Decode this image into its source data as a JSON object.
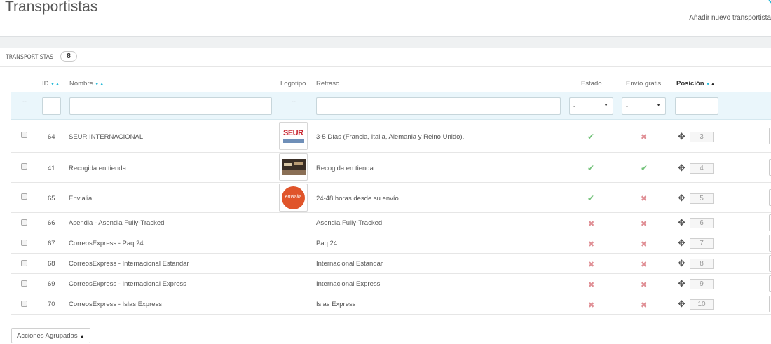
{
  "page": {
    "title": "Transportistas",
    "add_new": "Añadir nuevo transportista"
  },
  "panel": {
    "title": "TRANSPORTISTAS",
    "count": "8"
  },
  "columns": {
    "id": "ID",
    "name": "Nombre",
    "logo": "Logotipo",
    "delay": "Retraso",
    "status": "Estado",
    "free_shipping": "Envío gratis",
    "position": "Posición"
  },
  "filters": {
    "select_placeholder": "--",
    "status_value": "-",
    "free_value": "-"
  },
  "rows": [
    {
      "id": "64",
      "name": "SEUR INTERNACIONAL",
      "logo": "seur",
      "delay": "3-5 Días (Francia, Italia, Alemania y Reino Unido).",
      "status": true,
      "free": false,
      "position": "3"
    },
    {
      "id": "41",
      "name": "Recogida en tienda",
      "logo": "store",
      "delay": "Recogida en tienda",
      "status": true,
      "free": true,
      "position": "4"
    },
    {
      "id": "65",
      "name": "Envialia",
      "logo": "envialia",
      "delay": "24-48 horas desde su envío.",
      "status": true,
      "free": false,
      "position": "5"
    },
    {
      "id": "66",
      "name": "Asendia - Asendia Fully-Tracked",
      "logo": "",
      "delay": "Asendia Fully-Tracked",
      "status": false,
      "free": false,
      "position": "6"
    },
    {
      "id": "67",
      "name": "CorreosExpress - Paq 24",
      "logo": "",
      "delay": "Paq 24",
      "status": false,
      "free": false,
      "position": "7"
    },
    {
      "id": "68",
      "name": "CorreosExpress - Internacional Estandar",
      "logo": "",
      "delay": "Internacional Estandar",
      "status": false,
      "free": false,
      "position": "8"
    },
    {
      "id": "69",
      "name": "CorreosExpress - Internacional Express",
      "logo": "",
      "delay": "Internacional Express",
      "status": false,
      "free": false,
      "position": "9"
    },
    {
      "id": "70",
      "name": "CorreosExpress - Islas Express",
      "logo": "",
      "delay": "Islas Express",
      "status": false,
      "free": false,
      "position": "10"
    }
  ],
  "logos": {
    "seur_text": "SEUR",
    "envialia_text": "envialia"
  },
  "footer": {
    "bulk_actions": "Acciones Agrupadas"
  },
  "colors": {
    "accent": "#25b9d7",
    "check": "#72c279",
    "cross": "#e08f95"
  }
}
